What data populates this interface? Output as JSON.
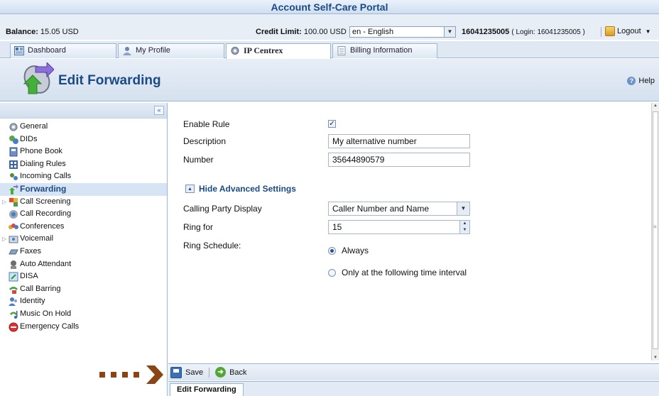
{
  "app": {
    "title": "Account Self-Care Portal"
  },
  "infobar": {
    "balance_label": "Balance:",
    "balance_value": "15.05 USD",
    "credit_label": "Credit Limit:",
    "credit_value": "100.00 USD",
    "language": "en - English",
    "account_number": "16041235005",
    "login_text": "( Login: 16041235005 )",
    "logout_label": "Logout"
  },
  "tabs": [
    {
      "label": "Dashboard",
      "icon": "dashboard-icon"
    },
    {
      "label": "My Profile",
      "icon": "user-icon"
    },
    {
      "label": "IP Centrex",
      "icon": "gear-icon"
    },
    {
      "label": "Billing Information",
      "icon": "document-icon"
    }
  ],
  "header": {
    "title": "Edit Forwarding",
    "help_label": "Help"
  },
  "sidebar": {
    "items": [
      {
        "label": "General",
        "icon": "gear-icon"
      },
      {
        "label": "DIDs",
        "icon": "did-icon"
      },
      {
        "label": "Phone Book",
        "icon": "phone-book-icon"
      },
      {
        "label": "Dialing Rules",
        "icon": "dialing-rules-icon"
      },
      {
        "label": "Incoming Calls",
        "icon": "incoming-calls-icon"
      },
      {
        "label": "Forwarding",
        "icon": "forwarding-icon"
      },
      {
        "label": "Call Screening",
        "icon": "call-screening-icon"
      },
      {
        "label": "Call Recording",
        "icon": "call-recording-icon"
      },
      {
        "label": "Conferences",
        "icon": "conferences-icon"
      },
      {
        "label": "Voicemail",
        "icon": "voicemail-icon"
      },
      {
        "label": "Faxes",
        "icon": "fax-icon"
      },
      {
        "label": "Auto Attendant",
        "icon": "auto-attendant-icon"
      },
      {
        "label": "DISA",
        "icon": "disa-icon"
      },
      {
        "label": "Call Barring",
        "icon": "call-barring-icon"
      },
      {
        "label": "Identity",
        "icon": "identity-icon"
      },
      {
        "label": "Music On Hold",
        "icon": "music-icon"
      },
      {
        "label": "Emergency Calls",
        "icon": "emergency-icon"
      }
    ]
  },
  "form": {
    "enable_rule_label": "Enable Rule",
    "enable_rule_checked": true,
    "description_label": "Description",
    "description_value": "My alternative number",
    "number_label": "Number",
    "number_value": "35644890579",
    "advanced_toggle": "Hide Advanced Settings",
    "calling_party_label": "Calling Party Display",
    "calling_party_value": "Caller Number and Name",
    "ring_for_label": "Ring for",
    "ring_for_value": "15",
    "ring_schedule_label": "Ring Schedule:",
    "schedule_always": "Always",
    "schedule_interval": "Only at the following time interval",
    "schedule_selected": "Always"
  },
  "toolbar": {
    "save_label": "Save",
    "back_label": "Back"
  },
  "footer": {
    "tab_label": "Edit Forwarding"
  },
  "colors": {
    "accent": "#1b4a86",
    "pointer_arrow": "#8a4512"
  }
}
